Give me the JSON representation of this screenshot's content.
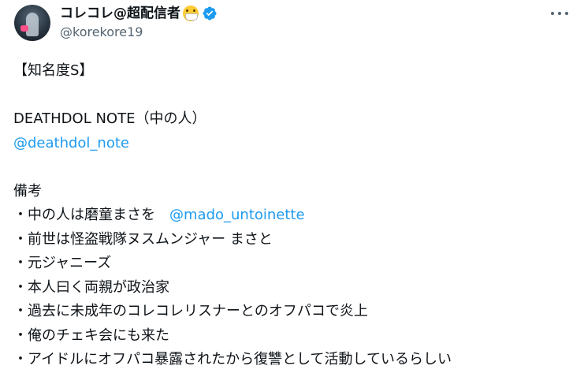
{
  "author": {
    "display_name": "コレコレ@超配信者",
    "handle": "@korekore19",
    "emoji": "face-with-medical-mask-icon",
    "verified_icon": "verified-badge-icon",
    "verified_color": "#1d9bf0"
  },
  "menu_icon": "more-options-icon",
  "body": {
    "line1": "【知名度S】",
    "line2": "DEATHDOL NOTE（中の人）",
    "mention1": "@deathdol_note",
    "line3": "備考",
    "bullet1_text": "・中の人は磨童まさを　",
    "bullet1_mention": "@mado_untoinette",
    "bullet2": "・前世は怪盗戦隊ヌスムンジャー まさと",
    "bullet3": "・元ジャニーズ",
    "bullet4": "・本人曰く両親が政治家",
    "bullet5": "・過去に未成年のコレコレリスナーとのオフパコで炎上",
    "bullet6": "・俺のチェキ会にも来た",
    "bullet7": "・アイドルにオフパコ暴露されたから復讐として活動しているらしい"
  },
  "colors": {
    "text": "#0f1419",
    "secondary": "#536471",
    "link": "#1d9bf0"
  }
}
